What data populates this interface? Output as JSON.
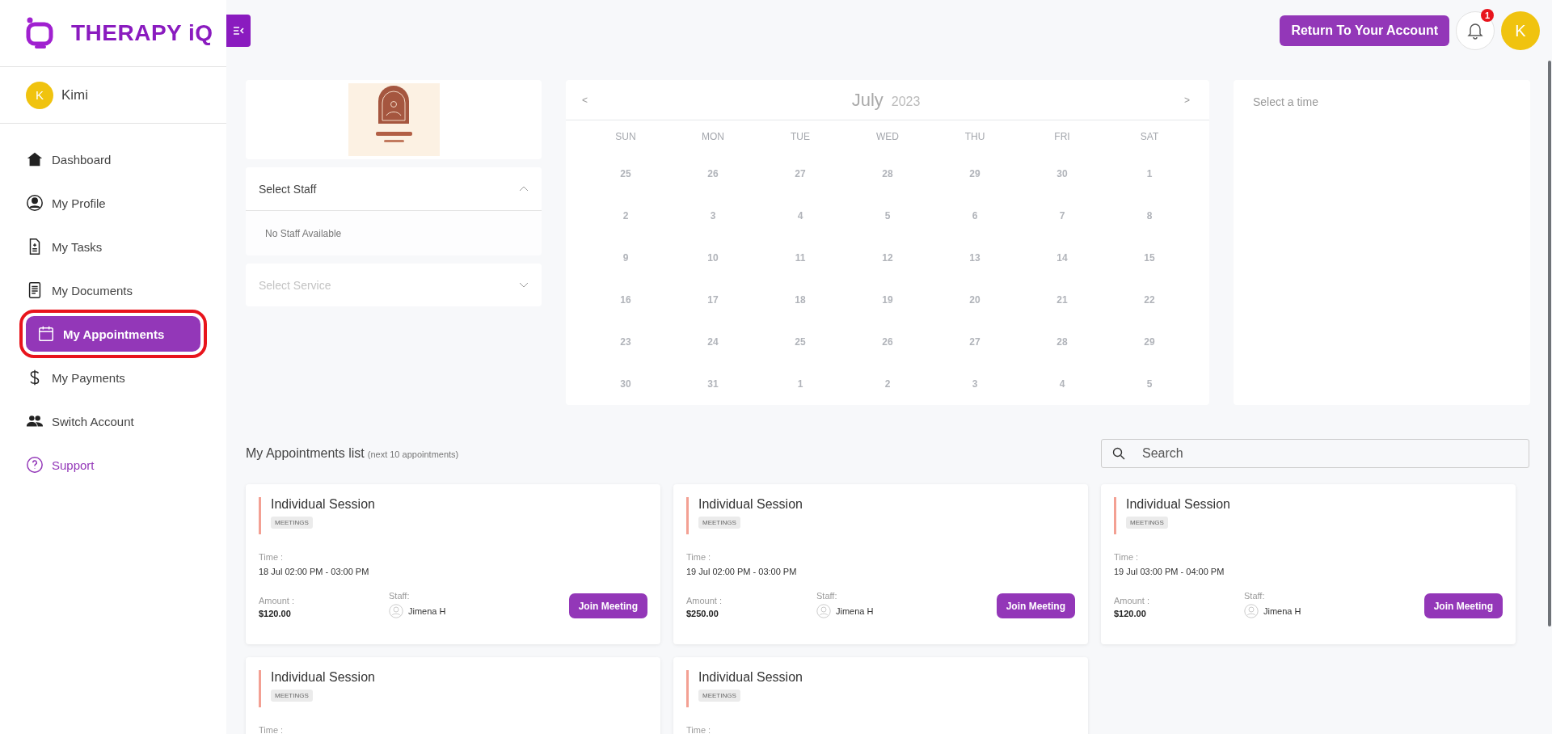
{
  "brand": {
    "name": "THERAPY iQ"
  },
  "user": {
    "initial": "K",
    "name": "Kimi"
  },
  "nav": [
    {
      "kind": "home",
      "label": "Dashboard",
      "selected": false
    },
    {
      "kind": "profile",
      "label": "My Profile",
      "selected": false
    },
    {
      "kind": "tasks",
      "label": "My Tasks",
      "selected": false
    },
    {
      "kind": "documents",
      "label": "My Documents",
      "selected": false
    },
    {
      "kind": "calendar",
      "label": "My Appointments",
      "selected": true
    },
    {
      "kind": "payments",
      "label": "My Payments",
      "selected": false
    },
    {
      "kind": "switch",
      "label": "Switch Account",
      "selected": false
    },
    {
      "kind": "support",
      "label": "Support",
      "selected": false
    }
  ],
  "header": {
    "return_button": "Return To Your Account",
    "notification_count": "1",
    "avatar_initial": "K"
  },
  "staff_select": {
    "label": "Select Staff",
    "expanded": true,
    "empty_text": "No Staff Available"
  },
  "service_select": {
    "placeholder": "Select Service",
    "expanded": false
  },
  "calendar": {
    "prev": "<",
    "next": ">",
    "month": "July",
    "year": "2023",
    "weekdays": [
      "SUN",
      "MON",
      "TUE",
      "WED",
      "THU",
      "FRI",
      "SAT"
    ],
    "weeks": [
      [
        "25",
        "26",
        "27",
        "28",
        "29",
        "30",
        "1"
      ],
      [
        "2",
        "3",
        "4",
        "5",
        "6",
        "7",
        "8"
      ],
      [
        "9",
        "10",
        "11",
        "12",
        "13",
        "14",
        "15"
      ],
      [
        "16",
        "17",
        "18",
        "19",
        "20",
        "21",
        "22"
      ],
      [
        "23",
        "24",
        "25",
        "26",
        "27",
        "28",
        "29"
      ],
      [
        "30",
        "31",
        "1",
        "2",
        "3",
        "4",
        "5"
      ]
    ]
  },
  "time_panel": {
    "placeholder": "Select a time"
  },
  "appointments": {
    "title": "My Appointments list",
    "subtitle": "(next 10 appointments)",
    "search_placeholder": "Search",
    "cards": [
      {
        "title": "Individual Session",
        "tag": "MEETINGS",
        "time_label": "Time :",
        "time": "18 Jul 02:00 PM - 03:00 PM",
        "amount_label": "Amount :",
        "amount": "$120.00",
        "staff_label": "Staff:",
        "staff": "Jimena H",
        "button": "Join Meeting"
      },
      {
        "title": "Individual Session",
        "tag": "MEETINGS",
        "time_label": "Time :",
        "time": "19 Jul 02:00 PM - 03:00 PM",
        "amount_label": "Amount :",
        "amount": "$250.00",
        "staff_label": "Staff:",
        "staff": "Jimena H",
        "button": "Join Meeting"
      },
      {
        "title": "Individual Session",
        "tag": "MEETINGS",
        "time_label": "Time :",
        "time": "19 Jul 03:00 PM - 04:00 PM",
        "amount_label": "Amount :",
        "amount": "$120.00",
        "staff_label": "Staff:",
        "staff": "Jimena H",
        "button": "Join Meeting"
      },
      {
        "title": "Individual Session",
        "tag": "MEETINGS",
        "time_label": "Time :"
      },
      {
        "title": "Individual Session",
        "tag": "MEETINGS",
        "time_label": "Time :"
      }
    ]
  }
}
